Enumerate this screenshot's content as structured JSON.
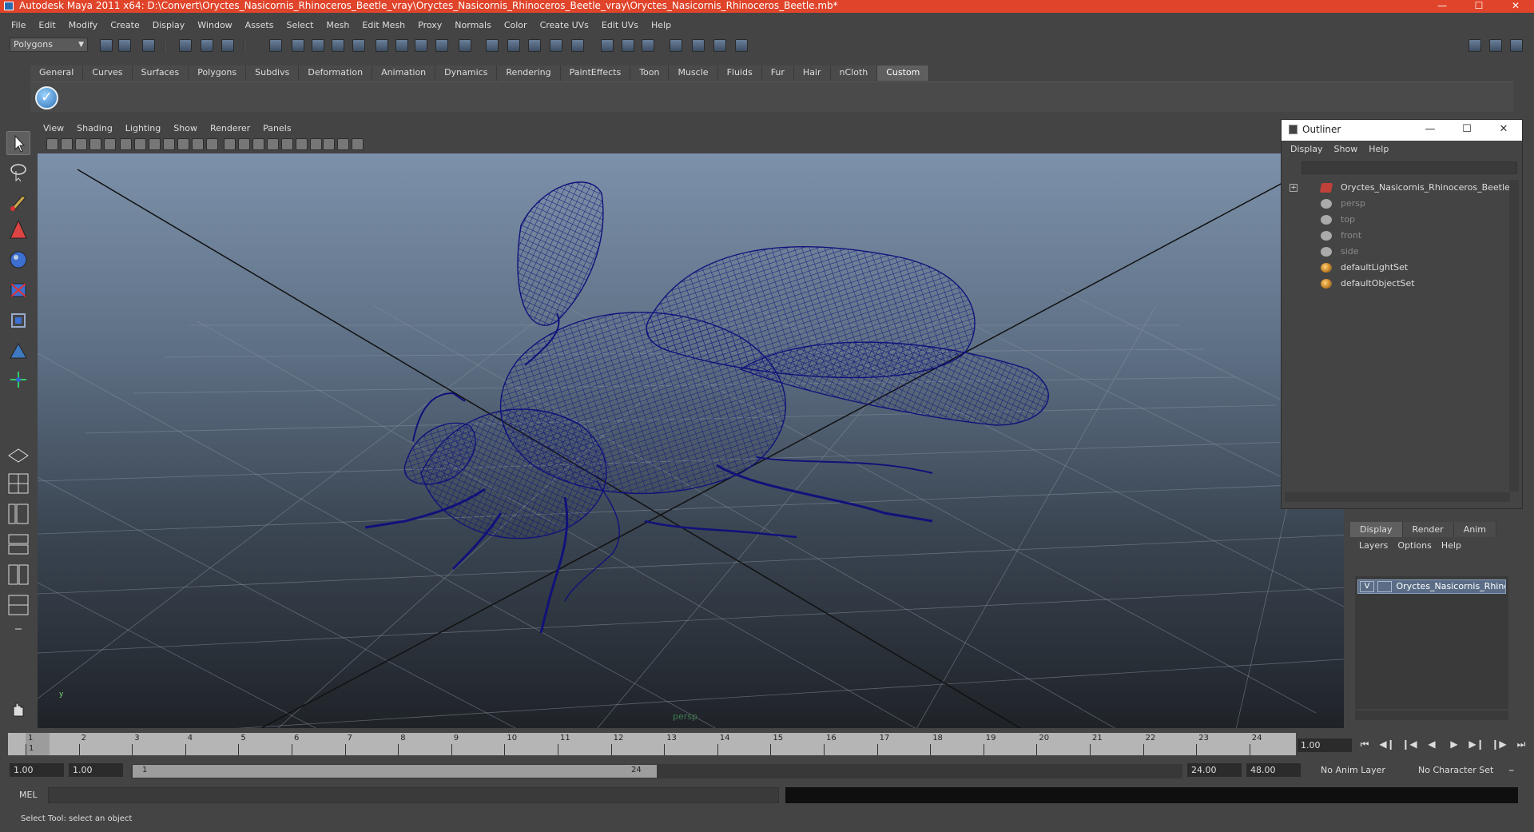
{
  "window": {
    "title": "Autodesk Maya 2011 x64: D:\\Convert\\Oryctes_Nasicornis_Rhinoceros_Beetle_vray\\Oryctes_Nasicornis_Rhinoceros_Beetle_vray\\Oryctes_Nasicornis_Rhinoceros_Beetle.mb*",
    "title_bar_color": "#e0442a"
  },
  "menubar": [
    "File",
    "Edit",
    "Modify",
    "Create",
    "Display",
    "Window",
    "Assets",
    "Select",
    "Mesh",
    "Edit Mesh",
    "Proxy",
    "Normals",
    "Color",
    "Create UVs",
    "Edit UVs",
    "Help"
  ],
  "statusline": {
    "mode": "Polygons"
  },
  "shelf": {
    "tabs": [
      "General",
      "Curves",
      "Surfaces",
      "Polygons",
      "Subdivs",
      "Deformation",
      "Animation",
      "Dynamics",
      "Rendering",
      "PaintEffects",
      "Toon",
      "Muscle",
      "Fluids",
      "Fur",
      "Hair",
      "nCloth",
      "Custom"
    ],
    "active_tab": "Custom"
  },
  "viewport": {
    "menu": [
      "View",
      "Shading",
      "Lighting",
      "Show",
      "Renderer",
      "Panels"
    ],
    "camera_label": "persp",
    "axis_label": "y",
    "wireframe_color": "#11117a"
  },
  "outliner": {
    "title": "Outliner",
    "menu": [
      "Display",
      "Show",
      "Help"
    ],
    "items": [
      {
        "label": "Oryctes_Nasicornis_Rhinoceros_Beetle",
        "icon": "mesh-icon",
        "dim": false,
        "expandable": true
      },
      {
        "label": "persp",
        "icon": "camera-icon",
        "dim": true
      },
      {
        "label": "top",
        "icon": "camera-icon",
        "dim": true
      },
      {
        "label": "front",
        "icon": "camera-icon",
        "dim": true
      },
      {
        "label": "side",
        "icon": "camera-icon",
        "dim": true
      },
      {
        "label": "defaultLightSet",
        "icon": "set-icon",
        "dim": false
      },
      {
        "label": "defaultObjectSet",
        "icon": "set-icon",
        "dim": false
      }
    ]
  },
  "layer_editor": {
    "tabs": [
      "Display",
      "Render",
      "Anim"
    ],
    "active_tab": "Display",
    "menu": [
      "Layers",
      "Options",
      "Help"
    ],
    "layer": {
      "visible": "V",
      "name": "Oryctes_Nasicornis_Rhinoceros_Beetle"
    }
  },
  "timeline": {
    "ticks": [
      "1",
      "2",
      "3",
      "4",
      "5",
      "6",
      "7",
      "8",
      "9",
      "10",
      "11",
      "12",
      "13",
      "14",
      "15",
      "16",
      "17",
      "18",
      "19",
      "20",
      "21",
      "22",
      "23",
      "24"
    ],
    "current_frame": "1",
    "current_time": "1.00"
  },
  "range": {
    "start_time": "1.00",
    "playback_start": "1.00",
    "range_start_label": "1",
    "range_end_label": "24",
    "playback_end": "24.00",
    "end_time": "48.00",
    "anim_layer": "No Anim Layer",
    "character_set": "No Character Set"
  },
  "command_line": {
    "label": "MEL"
  },
  "help_line": {
    "text": "Select Tool: select an object"
  }
}
